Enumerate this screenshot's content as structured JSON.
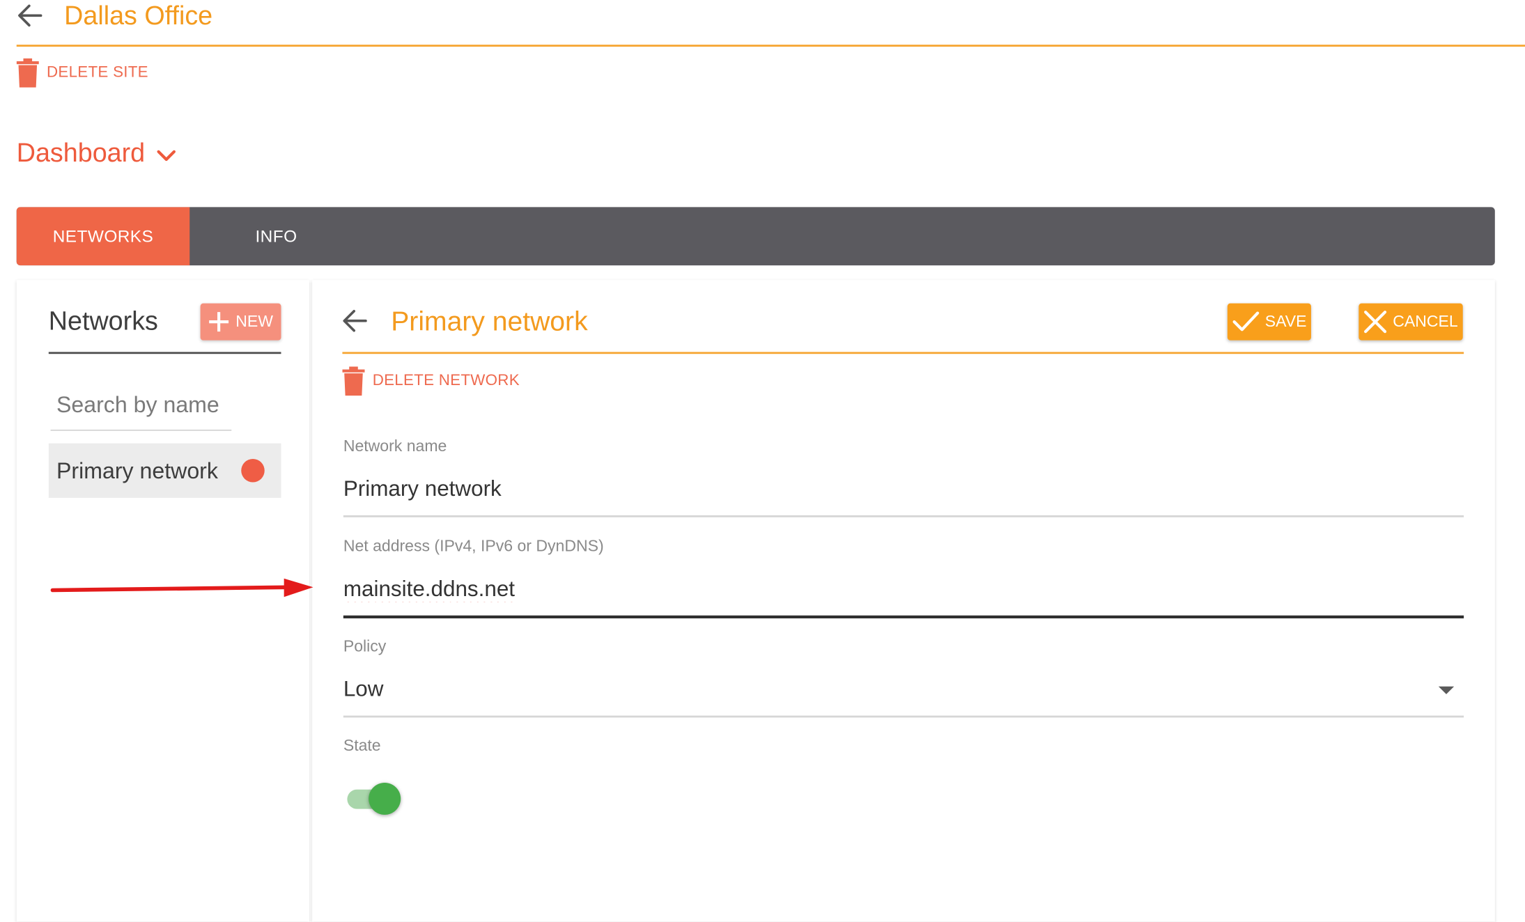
{
  "header": {
    "site_title": "Dallas Office",
    "delete_site_label": "DELETE SITE",
    "back_icon": "arrow-left-icon",
    "delete_icon": "trash-icon"
  },
  "dashboard": {
    "label": "Dashboard",
    "icon": "chevron-down-icon"
  },
  "tabs": [
    {
      "label": "NETWORKS",
      "active": true
    },
    {
      "label": "INFO",
      "active": false
    }
  ],
  "sidebar": {
    "title": "Networks",
    "new_button_label": "NEW",
    "search_placeholder": "Search by name",
    "search_value": "",
    "items": [
      {
        "label": "Primary network",
        "status_color": "#ef5d45"
      }
    ]
  },
  "editor": {
    "title": "Primary network",
    "save_label": "SAVE",
    "cancel_label": "CANCEL",
    "delete_label": "DELETE NETWORK",
    "fields": {
      "network_name": {
        "label": "Network name",
        "value": "Primary network"
      },
      "net_address": {
        "label": "Net address (IPv4, IPv6 or DynDNS)",
        "value": "mainsite.ddns.net"
      },
      "policy": {
        "label": "Policy",
        "value": "Low"
      },
      "state": {
        "label": "State",
        "enabled": true
      }
    }
  },
  "colors": {
    "accent_orange": "#f39a1e",
    "accent_red": "#ef6647",
    "tabbar": "#5b5a5f",
    "toggle_on": "#46ae4a",
    "annotation": "#e31b1b"
  }
}
